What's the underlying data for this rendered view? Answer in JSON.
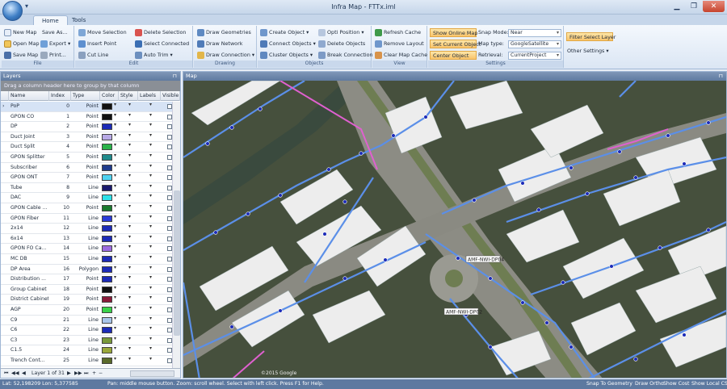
{
  "window": {
    "title": "Infra Map - FTTx.iml"
  },
  "ribbon_tabs": [
    "Home",
    "Tools"
  ],
  "ribbon": {
    "file": {
      "label": "File",
      "new_map": "New Map",
      "save_as": "Save As...",
      "open_map": "Open Map",
      "export": "Export",
      "save_map": "Save Map",
      "print": "Print..."
    },
    "edit": {
      "label": "Edit",
      "move_selection": "Move Selection",
      "delete_selection": "Delete Selection",
      "insert_point": "Insert Point",
      "select_connected": "Select Connected",
      "cut_line": "Cut Line",
      "auto_trim": "Auto Trim"
    },
    "drawing": {
      "label": "Drawing",
      "draw_geometries": "Draw Geometries",
      "draw_network": "Draw Network",
      "draw_connection": "Draw Connection"
    },
    "objects": {
      "label": "Objects",
      "create_object": "Create Object",
      "opti_position": "Opti Position",
      "connect_objects": "Connect Objects",
      "delete_objects": "Delete Objects",
      "cluster_objects": "Cluster Objects",
      "break_connection": "Break Connection"
    },
    "view": {
      "label": "View",
      "refresh_cache": "Refresh Cache",
      "remove_layout": "Remove Layout",
      "clear_map_cache": "Clear Map Cache"
    },
    "settings": {
      "label": "Settings",
      "show_online_map": "Show Online Map",
      "set_current_object": "Set Current Object",
      "center_object": "Center Object",
      "snap_mode_label": "Snap Mode:",
      "snap_mode_value": "Near",
      "map_type_label": "Map type:",
      "map_type_value": "GoogleSatellite",
      "retrieval_label": "Retrieval:",
      "retrieval_value": "CurrentProject",
      "filter_select_layer": "Filter Select Layer",
      "other_settings": "Other Settings"
    }
  },
  "layers_panel": {
    "title": "Layers",
    "group_hint": "Drag a column header here to group by that column",
    "columns": [
      "Name",
      "Index",
      "Type",
      "Color",
      "Style",
      "Labels",
      "Visible"
    ],
    "rows": [
      {
        "name": "PoP",
        "index": "0",
        "type": "Point",
        "color": "#111111"
      },
      {
        "name": "GPON CO",
        "index": "1",
        "type": "Point",
        "color": "#111111"
      },
      {
        "name": "DP",
        "index": "2",
        "type": "Point",
        "color": "#1c2bb8"
      },
      {
        "name": "Duct Joint",
        "index": "3",
        "type": "Point",
        "color": "#b7a9e6"
      },
      {
        "name": "Duct Split",
        "index": "4",
        "type": "Point",
        "color": "#2ab34a"
      },
      {
        "name": "GPON Splitter",
        "index": "5",
        "type": "Point",
        "color": "#1f8a8c"
      },
      {
        "name": "Subscriber",
        "index": "6",
        "type": "Point",
        "color": "#1f3b8c"
      },
      {
        "name": "GPON ONT",
        "index": "7",
        "type": "Point",
        "color": "#4fd2f0"
      },
      {
        "name": "Tube",
        "index": "8",
        "type": "Line",
        "color": "#1a1a6e"
      },
      {
        "name": "DAC",
        "index": "9",
        "type": "Line",
        "color": "#2de0e8"
      },
      {
        "name": "GPON Cable ...",
        "index": "10",
        "type": "Point",
        "color": "#1a7a2e"
      },
      {
        "name": "GPON Fiber",
        "index": "11",
        "type": "Line",
        "color": "#2a3bd8"
      },
      {
        "name": "2x14",
        "index": "12",
        "type": "Line",
        "color": "#1c2bb8"
      },
      {
        "name": "6x14",
        "index": "13",
        "type": "Line",
        "color": "#1c2bb8"
      },
      {
        "name": "GPON FO Ca...",
        "index": "14",
        "type": "Line",
        "color": "#9b6be0"
      },
      {
        "name": "MC DB",
        "index": "15",
        "type": "Line",
        "color": "#1c2bb8"
      },
      {
        "name": "DP Area",
        "index": "16",
        "type": "Polygon",
        "color": "#1c2bb8"
      },
      {
        "name": "Distribution ...",
        "index": "17",
        "type": "Point",
        "color": "#1c2bb8"
      },
      {
        "name": "Group Cabinet",
        "index": "18",
        "type": "Point",
        "color": "#111111"
      },
      {
        "name": "District Cabinet",
        "index": "19",
        "type": "Point",
        "color": "#8a1a3a"
      },
      {
        "name": "AGP",
        "index": "20",
        "type": "Point",
        "color": "#3ad24a"
      },
      {
        "name": "C9",
        "index": "21",
        "type": "Line",
        "color": "#a9c6ea"
      },
      {
        "name": "C6",
        "index": "22",
        "type": "Line",
        "color": "#1c2bb8"
      },
      {
        "name": "C3",
        "index": "23",
        "type": "Line",
        "color": "#7a9a3a"
      },
      {
        "name": "C1.5",
        "index": "24",
        "type": "Line",
        "color": "#9aa83a"
      },
      {
        "name": "Trench Cont...",
        "index": "25",
        "type": "Line",
        "color": "#5a6a2a"
      }
    ],
    "nav_text": "Layer 1 of 31"
  },
  "map_panel": {
    "title": "Map",
    "labels": [
      "AMF-NWI-DP04",
      "AMF-NWI-DP02"
    ],
    "copyright": "©2015 Google"
  },
  "statusbar": {
    "coords": "Lat: 52,198209 Lon: 5,377585",
    "hint": "Pan: middle mouse button. Zoom: scroll wheel. Select with left click. Press F1 for Help.",
    "snap": "Snap To Geometry",
    "ortho": "Draw Ortho",
    "cost": "Show Cost",
    "local_cs": "Show Local CS"
  }
}
